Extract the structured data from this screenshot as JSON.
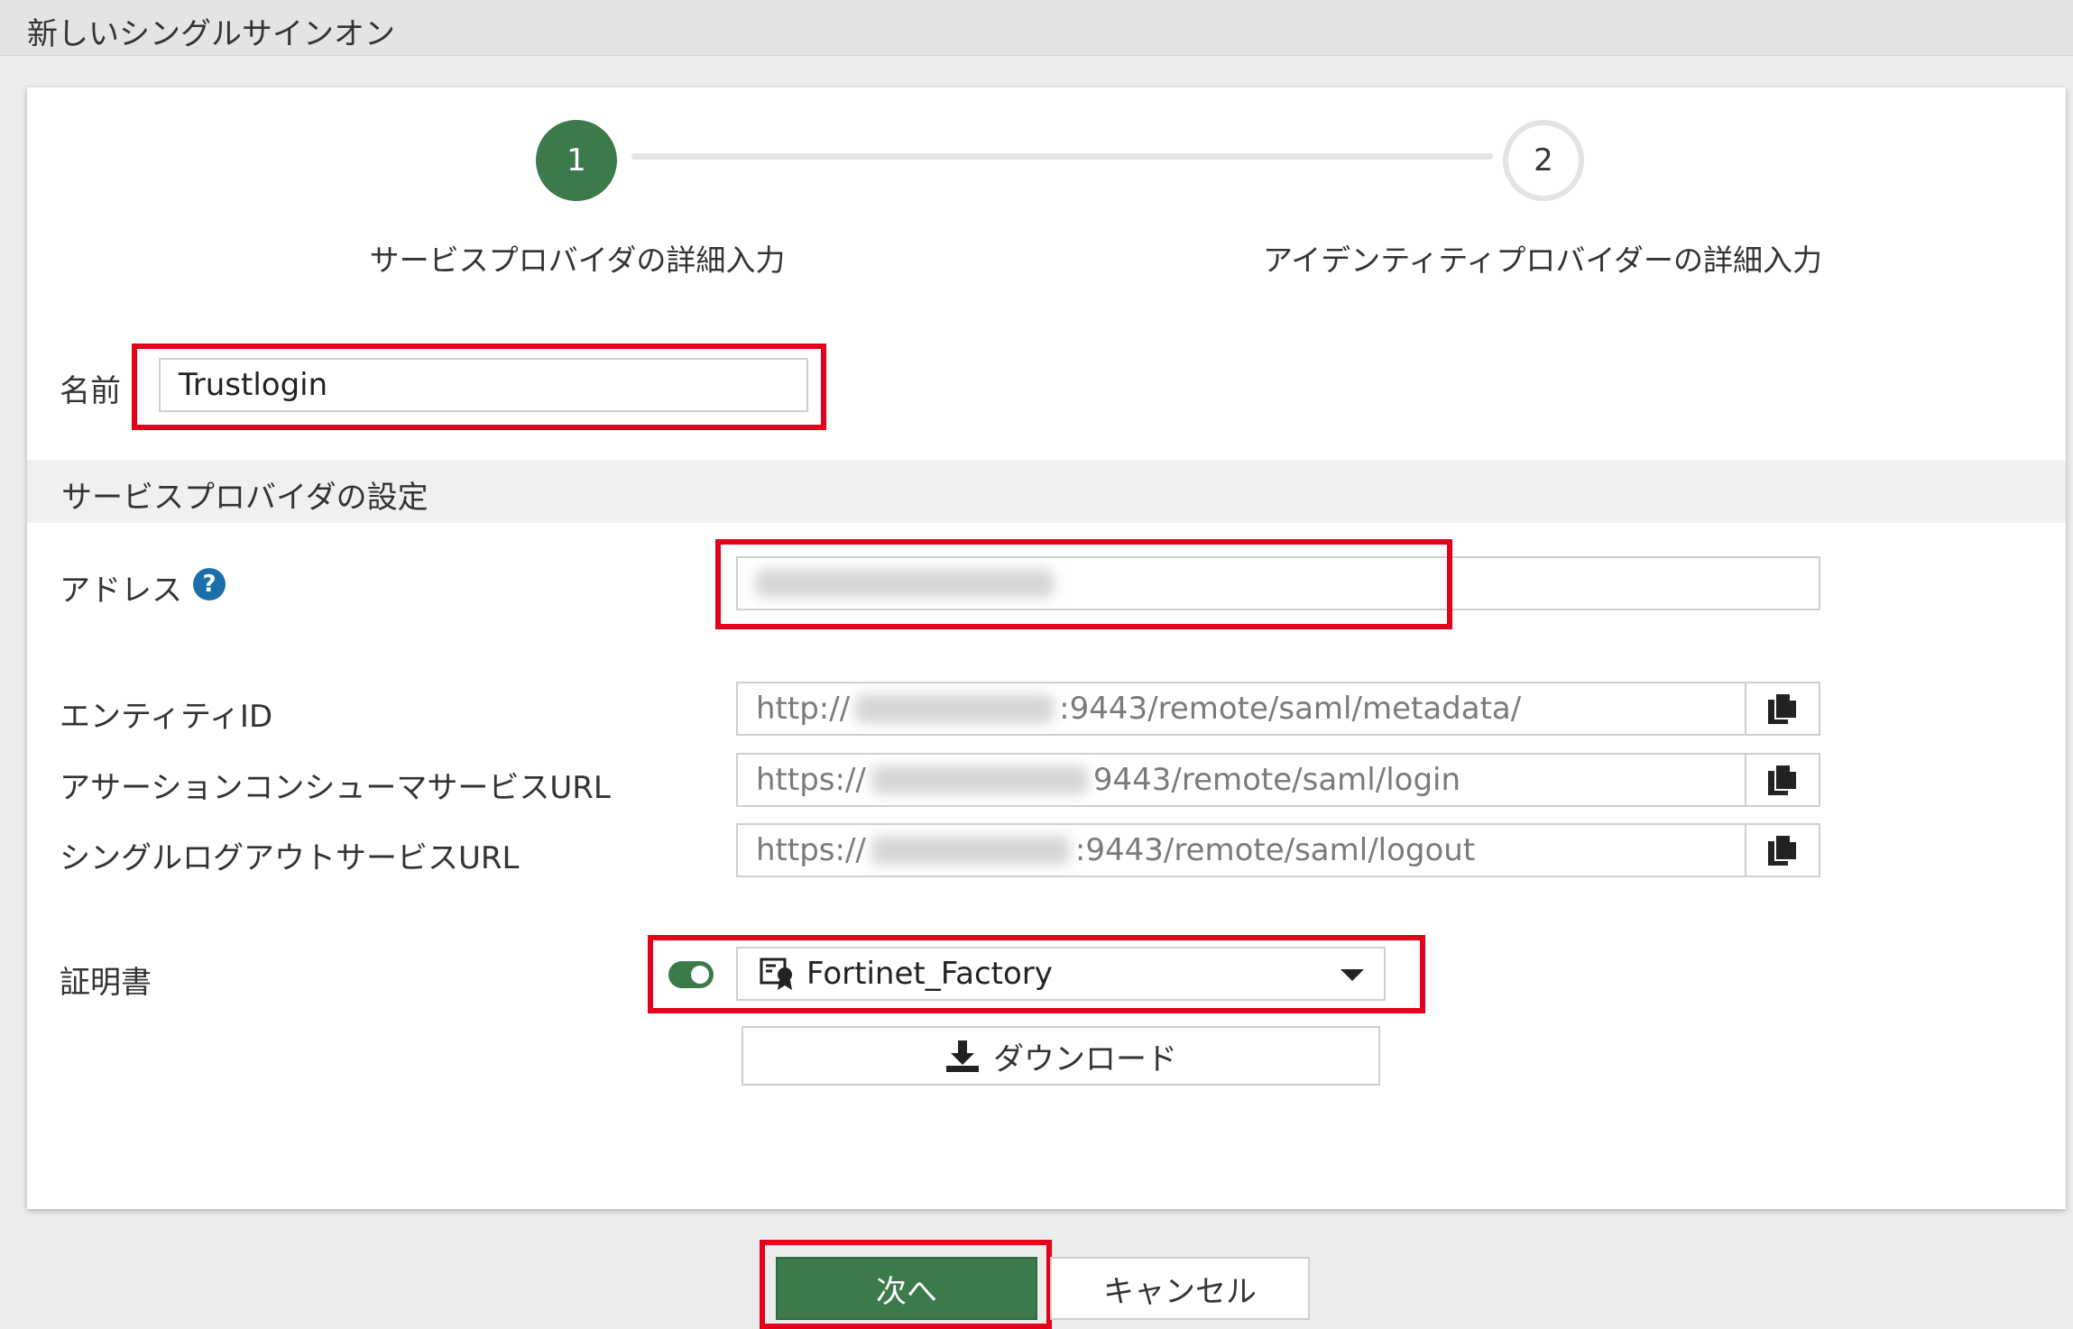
{
  "dialog": {
    "title": "新しいシングルサインオン"
  },
  "stepper": {
    "steps": [
      {
        "number": "1",
        "label": "サービスプロバイダの詳細入力",
        "active": true
      },
      {
        "number": "2",
        "label": "アイデンティティプロバイダーの詳細入力",
        "active": false
      }
    ]
  },
  "form": {
    "name_label": "名前",
    "name_value": "Trustlogin",
    "section_title": "サービスプロバイダの設定",
    "address_label": "アドレス",
    "address_help_icon": "question-circle-icon",
    "entity_id_label": "エンティティID",
    "entity_id_prefix": "http://",
    "entity_id_suffix": ":9443/remote/saml/metadata/",
    "acs_label": "アサーションコンシューマサービスURL",
    "acs_prefix": "https://",
    "acs_suffix": "9443/remote/saml/login",
    "slo_label": "シングルログアウトサービスURL",
    "slo_prefix": "https://",
    "slo_suffix": ":9443/remote/saml/logout",
    "copy_icon": "copy-icon",
    "certificate_label": "証明書",
    "certificate_toggle_on": true,
    "certificate_value": "Fortinet_Factory",
    "certificate_icon": "certificate-icon",
    "download_label": "ダウンロード",
    "download_icon": "download-icon"
  },
  "footer": {
    "next_label": "次へ",
    "cancel_label": "キャンセル"
  },
  "colors": {
    "primary": "#3c7a4c",
    "highlight": "#e4001b",
    "help": "#1a6fa8"
  }
}
